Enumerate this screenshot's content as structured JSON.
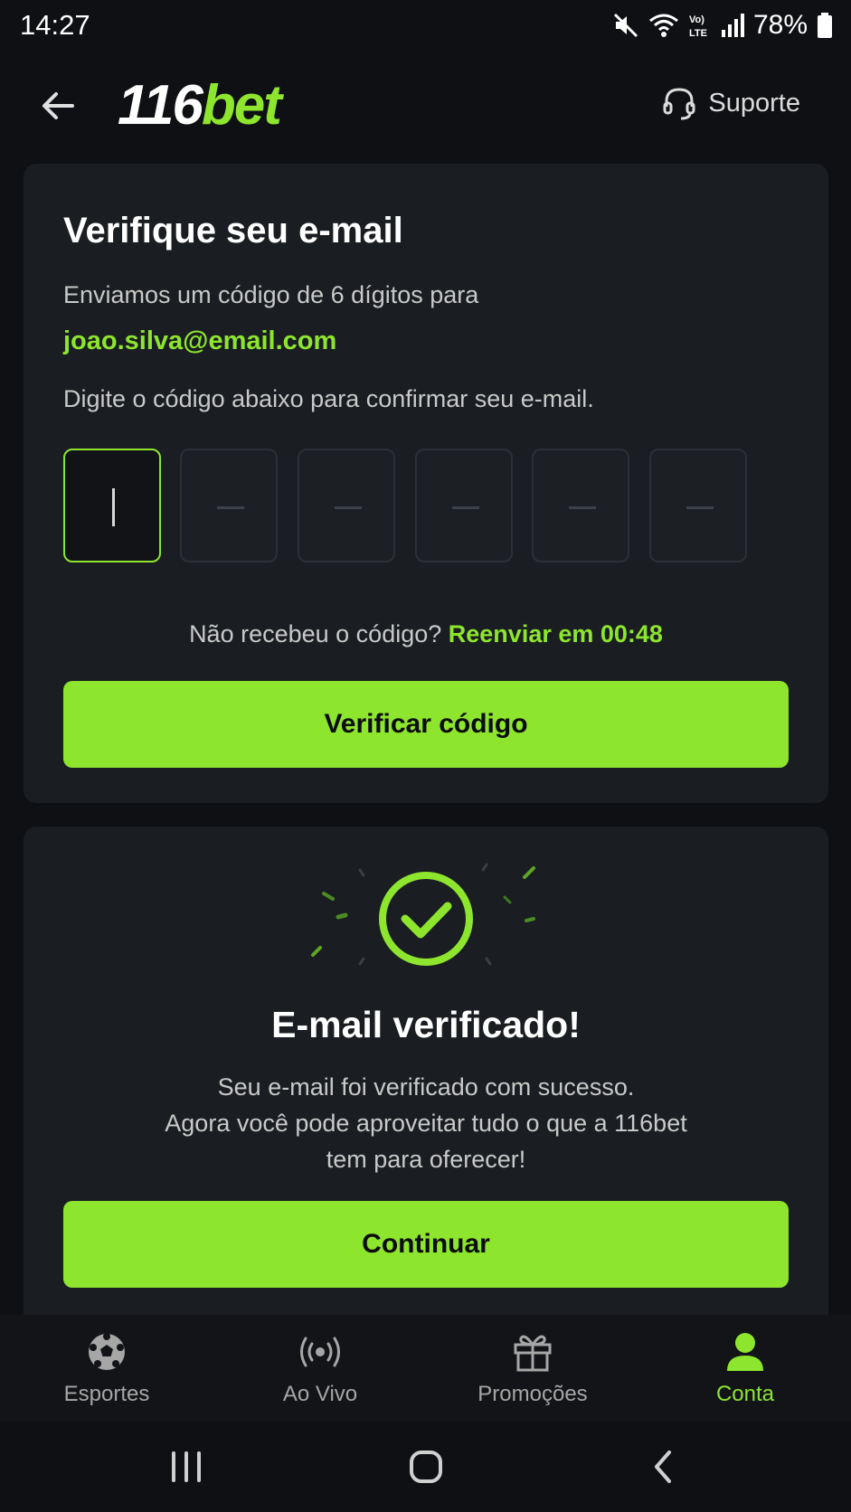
{
  "status_bar": {
    "time": "14:27",
    "battery": "78%",
    "network": "LTE"
  },
  "header": {
    "logo_numbers": "116",
    "logo_word": "bet",
    "support_label": "Suporte"
  },
  "verify": {
    "title": "Verifique seu e-mail",
    "sent_text": "Enviamos um código de 6 dígitos para",
    "email": "joao.silva@email.com",
    "instruction": "Digite o código abaixo para confirmar seu e-mail.",
    "code_length": 6,
    "resend_question": "Não recebeu o código?",
    "resend_link": "Reenviar em 00:48",
    "verify_button": "Verificar código"
  },
  "success": {
    "title": "E-mail verificado!",
    "message_line1": "Seu e-mail foi verificado com sucesso.",
    "message_line2": "Agora você pode aproveitar tudo o que a 116bet",
    "message_line3": "tem para oferecer!",
    "continue_button": "Continuar"
  },
  "bottom_nav": {
    "items": [
      {
        "label": "Esportes",
        "icon": "soccer-ball-icon"
      },
      {
        "label": "Ao Vivo",
        "icon": "live-broadcast-icon"
      },
      {
        "label": "Promoções",
        "icon": "gift-icon"
      },
      {
        "label": "Conta",
        "icon": "user-icon",
        "active": true
      }
    ]
  },
  "colors": {
    "accent": "#8de52e",
    "background": "#0e1013",
    "card": "#1a1d21"
  }
}
